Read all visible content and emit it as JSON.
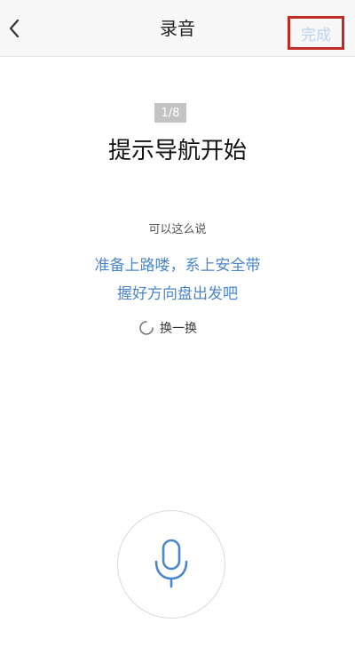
{
  "nav": {
    "title": "录音",
    "done_label": "完成"
  },
  "prompt": {
    "counter": "1/8",
    "title": "提示导航开始"
  },
  "hint": {
    "label": "可以这么说",
    "lines": [
      "准备上路喽，系上安全带",
      "握好方向盘出发吧"
    ],
    "refresh_label": "换一换"
  },
  "colors": {
    "accent_blue": "#4b86cc",
    "done_disabled": "#b8d3f2",
    "highlight_border": "#c22a24",
    "counter_bg": "#c3c3c3"
  },
  "icons": {
    "back": "chevron-left-icon",
    "refresh": "refresh-icon",
    "mic": "microphone-icon"
  }
}
